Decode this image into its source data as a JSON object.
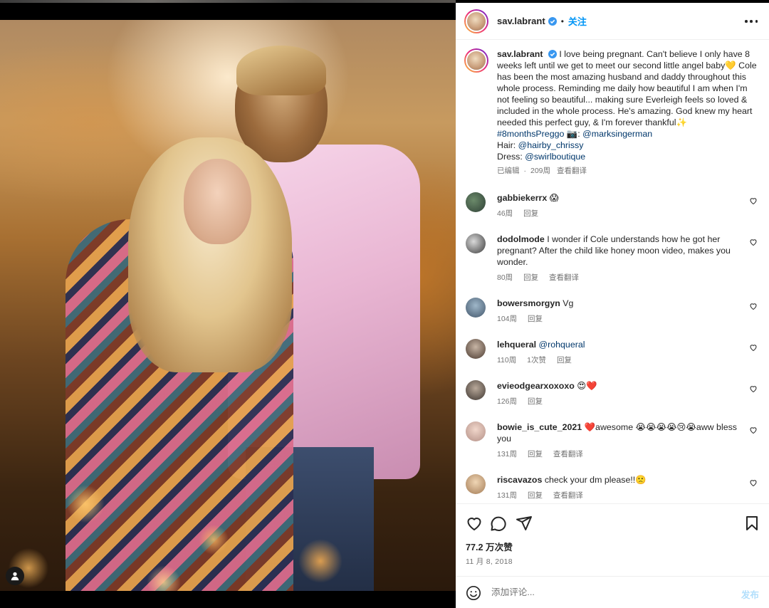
{
  "post": {
    "username": "sav.labrant",
    "follow_label": "关注",
    "separator": "•"
  },
  "caption": {
    "username": "sav.labrant",
    "text_1": "I love being pregnant. Can't believe I only have 8 weeks left until we get to meet our second little angel baby💛 Cole has been the most amazing husband and daddy throughout this whole process. Reminding me daily how beautiful I am when I'm not feeling so beautiful... making sure Everleigh feels so loved & included in the whole process. He's amazing. God knew my heart needed this perfect guy, & I'm forever thankful✨",
    "hashtag": "#8monthsPreggo",
    "camera_emoji": "📷",
    "colon": ":",
    "photographer": "@marksingerman",
    "hair_label": "Hair:",
    "hair_handle": "@hairby_chrissy",
    "dress_label": "Dress:",
    "dress_handle": "@swirlboutique",
    "edited": "已编辑",
    "dot": "·",
    "age": "209周",
    "translate": "查看翻译"
  },
  "comments": [
    {
      "username": "gabbiekerrx",
      "text": "😱",
      "age": "46周",
      "reply": "回复"
    },
    {
      "username": "dodolmode",
      "text": "I wonder if Cole understands how he got her pregnant? After the child like honey moon video, makes you wonder.",
      "age": "80周",
      "reply": "回复",
      "translate": "查看翻译"
    },
    {
      "username": "bowersmorgyn",
      "text": "Vg",
      "age": "104周",
      "reply": "回复"
    },
    {
      "username": "lehqueral",
      "mention": "@rohqueral",
      "age": "110周",
      "likes": "1次赞",
      "reply": "回复"
    },
    {
      "username": "evieodgearxoxoxo",
      "text": "😍❤️",
      "age": "126周",
      "reply": "回复"
    },
    {
      "username": "bowie_is_cute_2021",
      "text": "❤️awesome 😭😭😭😭😢😭aww bless you",
      "age": "131周",
      "reply": "回复",
      "translate": "查看翻译"
    },
    {
      "username": "riscavazos",
      "text": "check your dm please!!🙁",
      "age": "131周",
      "reply": "回复",
      "translate": "查看翻译"
    }
  ],
  "stats": {
    "likes": "77.2 万次赞",
    "date": "11 月 8, 2018"
  },
  "composer": {
    "placeholder": "添加评论...",
    "post_label": "发布"
  },
  "icons": {
    "like": "heart-icon",
    "comment": "comment-bubble-icon",
    "share": "paper-plane-icon",
    "save": "bookmark-icon",
    "more": "more-dots-icon",
    "verified": "verified-badge-icon",
    "emoji": "smiley-icon",
    "user_tag": "user-tag-icon"
  },
  "colors": {
    "accent": "#0095f6",
    "verified": "#3897f0",
    "link": "#00376b",
    "muted": "#737373",
    "post_disabled": "#b2dffc",
    "heart_red": "#ed4956"
  }
}
